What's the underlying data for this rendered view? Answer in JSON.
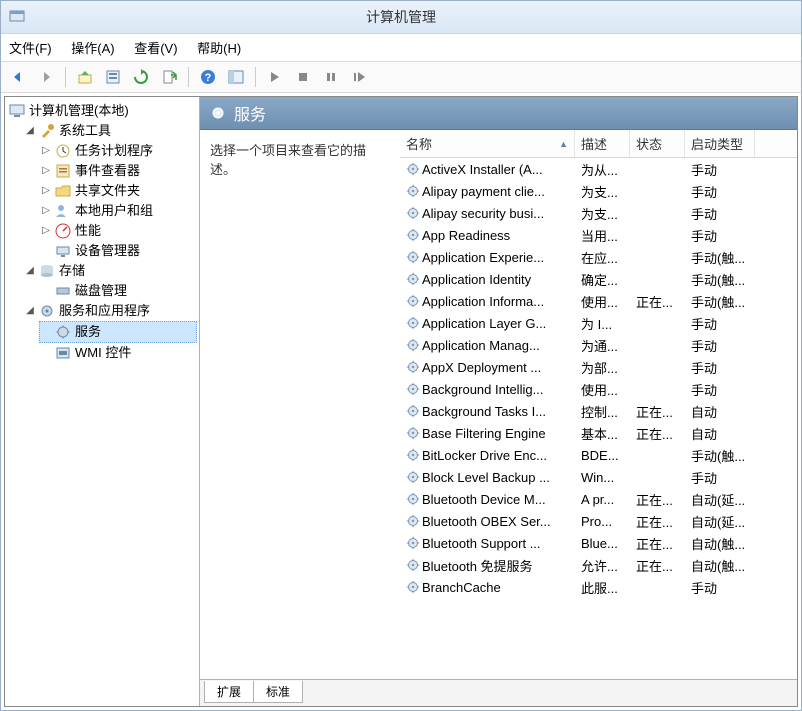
{
  "window": {
    "title": "计算机管理"
  },
  "menu": {
    "file": "文件(F)",
    "action": "操作(A)",
    "view": "查看(V)",
    "help": "帮助(H)"
  },
  "tree": {
    "root": "计算机管理(本地)",
    "system_tools": "系统工具",
    "task_scheduler": "任务计划程序",
    "event_viewer": "事件查看器",
    "shared_folders": "共享文件夹",
    "local_users": "本地用户和组",
    "performance": "性能",
    "device_manager": "设备管理器",
    "storage": "存储",
    "disk_mgmt": "磁盘管理",
    "services_apps": "服务和应用程序",
    "services": "服务",
    "wmi": "WMI 控件"
  },
  "detail": {
    "heading": "服务",
    "instruction": "选择一个项目来查看它的描述。",
    "tabs": {
      "ext": "扩展",
      "std": "标准"
    },
    "columns": {
      "name": "名称",
      "desc": "描述",
      "state": "状态",
      "startup": "启动类型"
    }
  },
  "services": [
    {
      "name": "ActiveX Installer (A...",
      "desc": "为从...",
      "state": "",
      "startup": "手动"
    },
    {
      "name": "Alipay payment clie...",
      "desc": "为支...",
      "state": "",
      "startup": "手动"
    },
    {
      "name": "Alipay security busi...",
      "desc": "为支...",
      "state": "",
      "startup": "手动"
    },
    {
      "name": "App Readiness",
      "desc": "当用...",
      "state": "",
      "startup": "手动"
    },
    {
      "name": "Application Experie...",
      "desc": "在应...",
      "state": "",
      "startup": "手动(触..."
    },
    {
      "name": "Application Identity",
      "desc": "确定...",
      "state": "",
      "startup": "手动(触..."
    },
    {
      "name": "Application Informa...",
      "desc": "使用...",
      "state": "正在...",
      "startup": "手动(触..."
    },
    {
      "name": "Application Layer G...",
      "desc": "为 I...",
      "state": "",
      "startup": "手动"
    },
    {
      "name": "Application Manag...",
      "desc": "为通...",
      "state": "",
      "startup": "手动"
    },
    {
      "name": "AppX Deployment ...",
      "desc": "为部...",
      "state": "",
      "startup": "手动"
    },
    {
      "name": "Background Intellig...",
      "desc": "使用...",
      "state": "",
      "startup": "手动"
    },
    {
      "name": "Background Tasks I...",
      "desc": "控制...",
      "state": "正在...",
      "startup": "自动"
    },
    {
      "name": "Base Filtering Engine",
      "desc": "基本...",
      "state": "正在...",
      "startup": "自动"
    },
    {
      "name": "BitLocker Drive Enc...",
      "desc": "BDE...",
      "state": "",
      "startup": "手动(触..."
    },
    {
      "name": "Block Level Backup ...",
      "desc": "Win...",
      "state": "",
      "startup": "手动"
    },
    {
      "name": "Bluetooth Device M...",
      "desc": "A pr...",
      "state": "正在...",
      "startup": "自动(延..."
    },
    {
      "name": "Bluetooth OBEX Ser...",
      "desc": "Pro...",
      "state": "正在...",
      "startup": "自动(延..."
    },
    {
      "name": "Bluetooth Support ...",
      "desc": "Blue...",
      "state": "正在...",
      "startup": "自动(触..."
    },
    {
      "name": "Bluetooth 免提服务",
      "desc": "允许...",
      "state": "正在...",
      "startup": "自动(触..."
    },
    {
      "name": "BranchCache",
      "desc": "此服...",
      "state": "",
      "startup": "手动"
    }
  ]
}
